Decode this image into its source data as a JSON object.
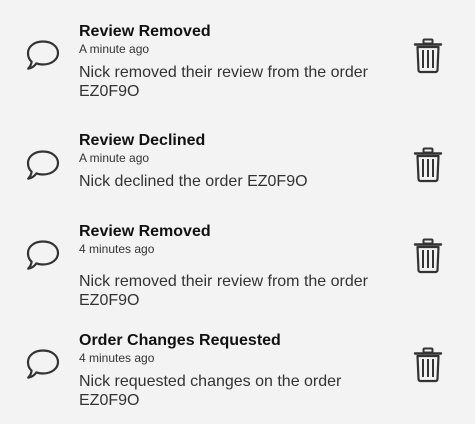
{
  "notifications": [
    {
      "title": "Review Removed",
      "time": "A minute ago",
      "message": "Nick removed their review from the order EZ0F9O",
      "icon": "chat-bubble-icon",
      "action_icon": "trash-icon"
    },
    {
      "title": "Review Declined",
      "time": "A minute ago",
      "message": "Nick declined the order EZ0F9O",
      "icon": "chat-bubble-icon",
      "action_icon": "trash-icon"
    },
    {
      "title": "Review Removed",
      "time": "4 minutes ago",
      "message": "Nick removed their review from the order EZ0F9O",
      "icon": "chat-bubble-icon",
      "action_icon": "trash-icon"
    },
    {
      "title": "Order Changes Requested",
      "time": "4 minutes ago",
      "message": "Nick requested changes on the order EZ0F9O",
      "icon": "chat-bubble-icon",
      "action_icon": "trash-icon"
    }
  ],
  "colors": {
    "background": "#f3f3f3",
    "icon": "#333333",
    "title": "#111111",
    "text": "#333333"
  }
}
